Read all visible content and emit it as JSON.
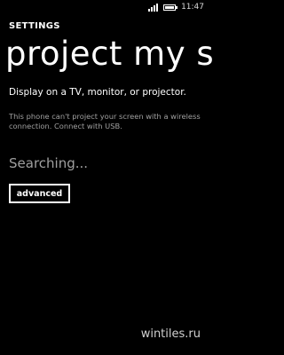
{
  "status_bar": {
    "time": "11:47",
    "signal_icon": "signal-strength-icon",
    "battery_icon": "battery-icon"
  },
  "app": {
    "title": "SETTINGS"
  },
  "page": {
    "title": "project my screen",
    "description": "Display on a TV, monitor, or projector.",
    "info": "This phone can't project your screen with a wireless connection. Connect with USB.",
    "status": "Searching...",
    "advanced_label": "advanced"
  },
  "watermark": {
    "text": "wintiles.ru"
  },
  "colors": {
    "background": "#000000",
    "text": "#ffffff",
    "secondary_text": "#a0a0a0"
  }
}
